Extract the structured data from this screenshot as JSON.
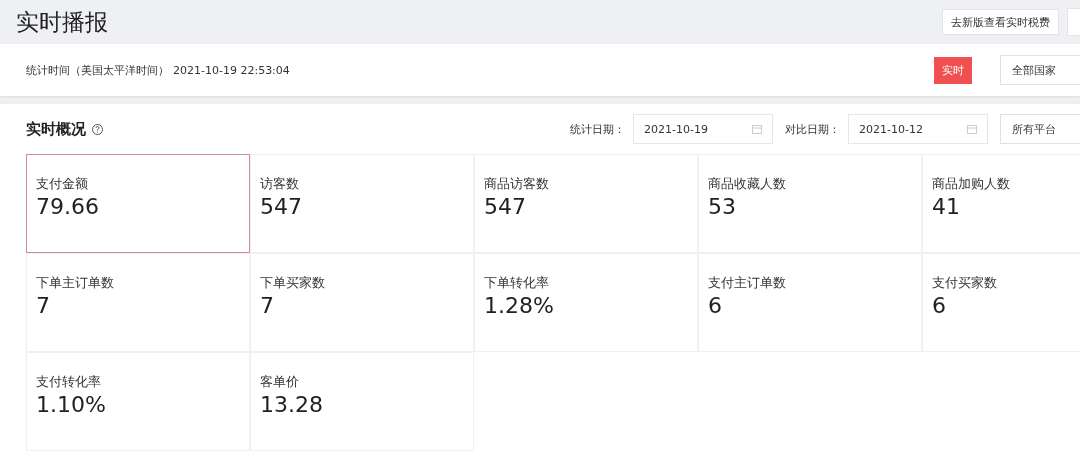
{
  "page": {
    "title": "实时播报",
    "toolbar_buttons": [
      {
        "label": "去新版查看实时税费"
      }
    ]
  },
  "stats_bar": {
    "time_label": "统计时间（美国太平洋时间）",
    "time_value": "2021-10-19 22:53:04",
    "realtime_button": {
      "label": "实时",
      "selected": true
    },
    "country_select": {
      "value": "全部国家"
    }
  },
  "overview": {
    "title": "实时概况",
    "date_label": "统计日期：",
    "date_value": "2021-10-19",
    "compare_label": "对比日期：",
    "compare_value": "2021-10-12",
    "platform_select": {
      "value": "所有平台"
    },
    "metrics": [
      {
        "label": "支付金额",
        "value": "79.66",
        "selected": true
      },
      {
        "label": "访客数",
        "value": "547",
        "selected": false
      },
      {
        "label": "商品访客数",
        "value": "547",
        "selected": false
      },
      {
        "label": "商品收藏人数",
        "value": "53",
        "selected": false
      },
      {
        "label": "商品加购人数",
        "value": "41",
        "selected": false
      },
      {
        "label": "下单主订单数",
        "value": "7",
        "selected": false
      },
      {
        "label": "下单买家数",
        "value": "7",
        "selected": false
      },
      {
        "label": "下单转化率",
        "value": "1.28%",
        "selected": false
      },
      {
        "label": "支付主订单数",
        "value": "6",
        "selected": false
      },
      {
        "label": "支付买家数",
        "value": "6",
        "selected": false
      },
      {
        "label": "支付转化率",
        "value": "1.10%",
        "selected": false
      },
      {
        "label": "客单价",
        "value": "13.28",
        "selected": false
      }
    ]
  }
}
